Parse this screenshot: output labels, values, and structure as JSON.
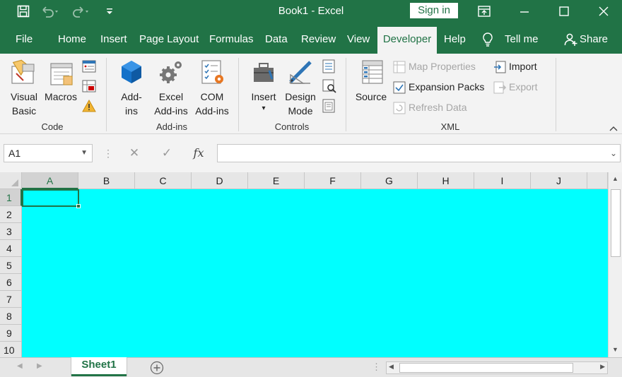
{
  "window": {
    "title": "Book1  -  Excel",
    "signin_label": "Sign in"
  },
  "tabs": [
    {
      "label": "File"
    },
    {
      "label": "Home"
    },
    {
      "label": "Insert"
    },
    {
      "label": "Page Layout"
    },
    {
      "label": "Formulas"
    },
    {
      "label": "Data"
    },
    {
      "label": "Review"
    },
    {
      "label": "View"
    },
    {
      "label": "Developer"
    },
    {
      "label": "Help"
    },
    {
      "label": "Tell me"
    },
    {
      "label": "Share"
    }
  ],
  "ribbon": {
    "code": {
      "label": "Code",
      "visual_basic": [
        "Visual",
        "Basic"
      ],
      "macros": "Macros"
    },
    "addins": {
      "label": "Add-ins",
      "addins": [
        "Add-",
        "ins"
      ],
      "excel_addins": [
        "Excel",
        "Add-ins"
      ],
      "com_addins": [
        "COM",
        "Add-ins"
      ]
    },
    "controls": {
      "label": "Controls",
      "insert": "Insert",
      "design_mode": [
        "Design",
        "Mode"
      ]
    },
    "xml": {
      "label": "XML",
      "source": "Source",
      "map_properties": "Map Properties",
      "expansion_packs": "Expansion Packs",
      "refresh_data": "Refresh Data",
      "import": "Import",
      "export": "Export"
    }
  },
  "formula_bar": {
    "name_box": "A1",
    "fx": "fx",
    "value": ""
  },
  "grid": {
    "columns": [
      "A",
      "B",
      "C",
      "D",
      "E",
      "F",
      "G",
      "H",
      "I",
      "J"
    ],
    "rows": [
      "1",
      "2",
      "3",
      "4",
      "5",
      "6",
      "7",
      "8",
      "9",
      "10"
    ],
    "fill_color": "#00ffff",
    "active_cell": "A1"
  },
  "sheets": [
    {
      "label": "Sheet1"
    }
  ],
  "colors": {
    "accent": "#217346",
    "ribbon_bg": "#f3f3f3",
    "cell_fill": "#00ffff"
  }
}
